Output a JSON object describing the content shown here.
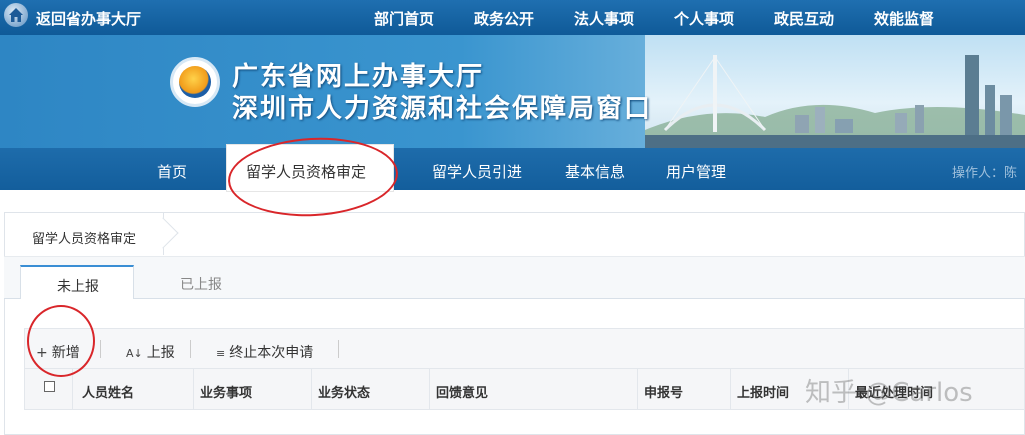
{
  "topbar": {
    "back_label": "返回省办事大厅",
    "nav": [
      "部门首页",
      "政务公开",
      "法人事项",
      "个人事项",
      "政民互动",
      "效能监督"
    ]
  },
  "banner": {
    "title_line1": "广东省网上办事大厅",
    "title_line2": "深圳市人力资源和社会保障局窗口"
  },
  "mainnav": {
    "items": [
      "首页",
      "留学人员资格审定",
      "留学人员引进",
      "基本信息",
      "用户管理"
    ],
    "active_index": 1,
    "operator_label": "操作人：陈"
  },
  "breadcrumb": "留学人员资格审定",
  "tabs": [
    "未上报",
    "已上报"
  ],
  "toolbar": {
    "add": "新增",
    "report": "上报",
    "terminate": "终止本次申请"
  },
  "table": {
    "headers": [
      "人员姓名",
      "业务事项",
      "业务状态",
      "回馈意见",
      "申报号",
      "上报时间",
      "最近处理时间"
    ]
  },
  "watermark": "知乎 @Carlos",
  "colors": {
    "nav_blue": "#135e9c",
    "annotation_red": "#d9262a",
    "accent_tab": "#3a8ed4"
  }
}
